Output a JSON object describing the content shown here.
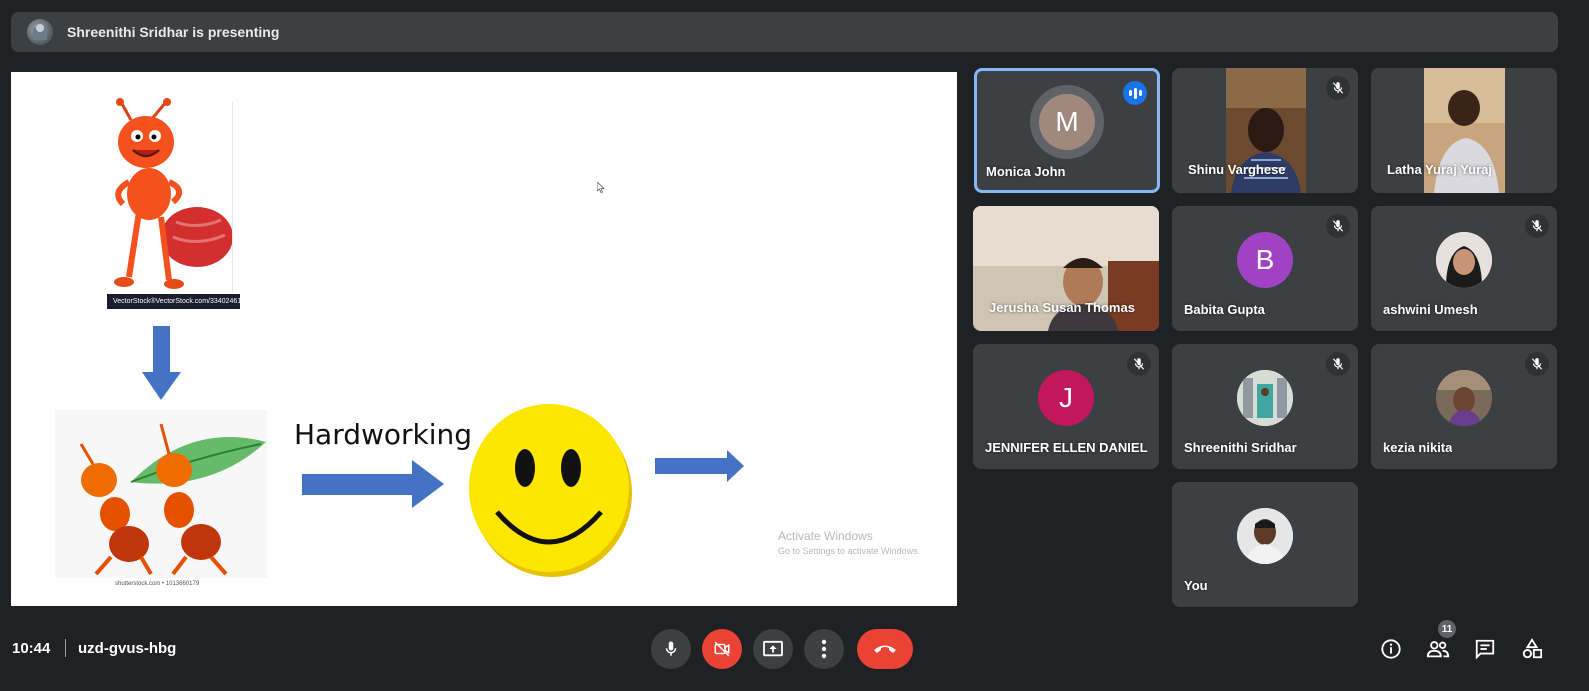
{
  "banner": {
    "text": "Shreenithi Sridhar is presenting"
  },
  "slide": {
    "label": "Hardworking",
    "vectorstock_brand": "VectorStock®",
    "vectorstock_url": "VectorStock.com/33402461",
    "shutterstock_credit": "shutterstock.com • 1013660179",
    "activate_title": "Activate Windows",
    "activate_sub": "Go to Settings to activate Windows."
  },
  "participants": [
    {
      "name": "Monica John",
      "initial": "M",
      "avatar_color": "#a1887f",
      "state": "speaking"
    },
    {
      "name": "Shinu Varghese",
      "state": "muted",
      "video": true
    },
    {
      "name": "Latha Yuraj Yuraj",
      "state": "none",
      "video": true
    },
    {
      "name": "Jerusha Susan Thomas",
      "state": "none",
      "video": true
    },
    {
      "name": "Babita Gupta",
      "initial": "B",
      "avatar_color": "#a142c4",
      "state": "muted"
    },
    {
      "name": "ashwini Umesh",
      "state": "muted"
    },
    {
      "name": "JENNIFER ELLEN DANIEL",
      "initial": "J",
      "avatar_color": "#c2185b",
      "state": "muted"
    },
    {
      "name": "Shreenithi Sridhar",
      "state": "muted"
    },
    {
      "name": "kezia nikita",
      "state": "muted"
    },
    {
      "name": "You",
      "state": "none"
    }
  ],
  "bottom": {
    "time": "10:44",
    "meeting_code": "uzd-gvus-hbg",
    "people_count": "11"
  },
  "colors": {
    "background": "#202124",
    "tile": "#3c4043",
    "end_call": "#ea4335",
    "active_border": "#8ab4f8"
  }
}
